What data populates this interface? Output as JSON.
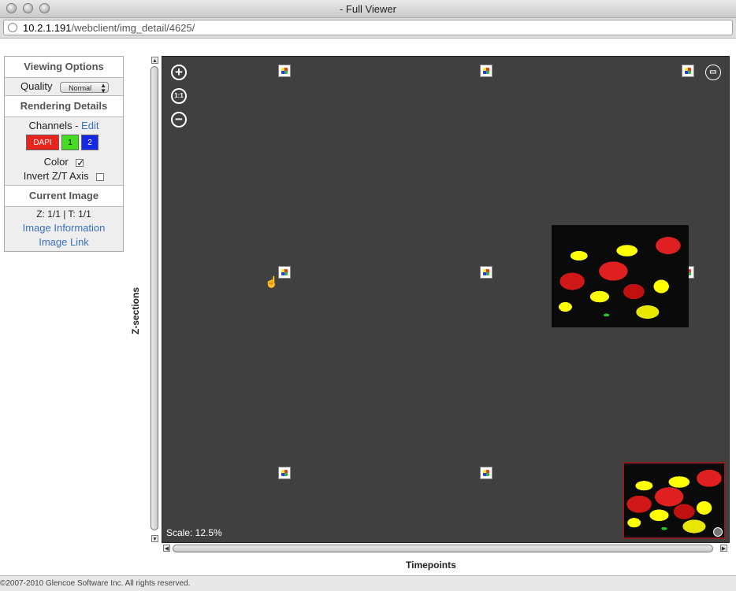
{
  "window": {
    "title": "- Full Viewer"
  },
  "url": {
    "host": "10.2.1.191",
    "path": "/webclient/img_detail/4625/"
  },
  "panel": {
    "viewing_options": "Viewing Options",
    "quality_label": "Quality",
    "quality_value": "Normal",
    "rendering_details": "Rendering Details",
    "channels_label": "Channels -",
    "channels_edit": "Edit",
    "channels": [
      {
        "label": "DAPI",
        "color": "#e8241c",
        "text_color": "#ffffff"
      },
      {
        "label": "1",
        "color": "#44dd22",
        "text_color": "#000000"
      },
      {
        "label": "2",
        "color": "#1428e6",
        "text_color": "#ffffff"
      }
    ],
    "color_label": "Color",
    "color_checked": true,
    "invert_label": "Invert Z/T Axis",
    "invert_checked": false,
    "current_image": "Current Image",
    "zt_status": "Z: 1/1 | T: 1/1",
    "image_information": "Image Information",
    "image_link": "Image Link"
  },
  "viewer": {
    "background": "#404040",
    "zoom_in": "+",
    "zoom_reset": "1:1",
    "zoom_out": "−",
    "scale": "Scale: 12.5%"
  },
  "axes": {
    "z_label": "Z-sections",
    "t_label": "Timepoints"
  },
  "footer": {
    "copyright": "©2007-2010 Glencoe Software Inc. All rights reserved."
  }
}
